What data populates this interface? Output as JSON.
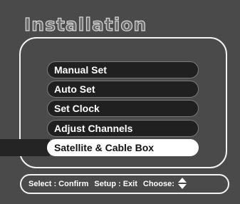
{
  "screen": {
    "title": "Installation"
  },
  "menu": {
    "items": [
      {
        "label": "Manual Set"
      },
      {
        "label": "Auto Set"
      },
      {
        "label": "Set Clock"
      },
      {
        "label": "Adjust Channels"
      },
      {
        "label": "Satellite & Cable Box"
      }
    ],
    "selected_label": "Satellite & Cable Box"
  },
  "footer": {
    "select_label": "Select : Confirm",
    "setup_label": "Setup : Exit",
    "choose_label": "Choose:"
  },
  "colors": {
    "background": "#4a4a4a",
    "item_background": "#202020",
    "selected_background": "#ffffff",
    "frame": "#f2f2f2"
  },
  "icons": {
    "choose": "up-down-arrow-icon"
  }
}
